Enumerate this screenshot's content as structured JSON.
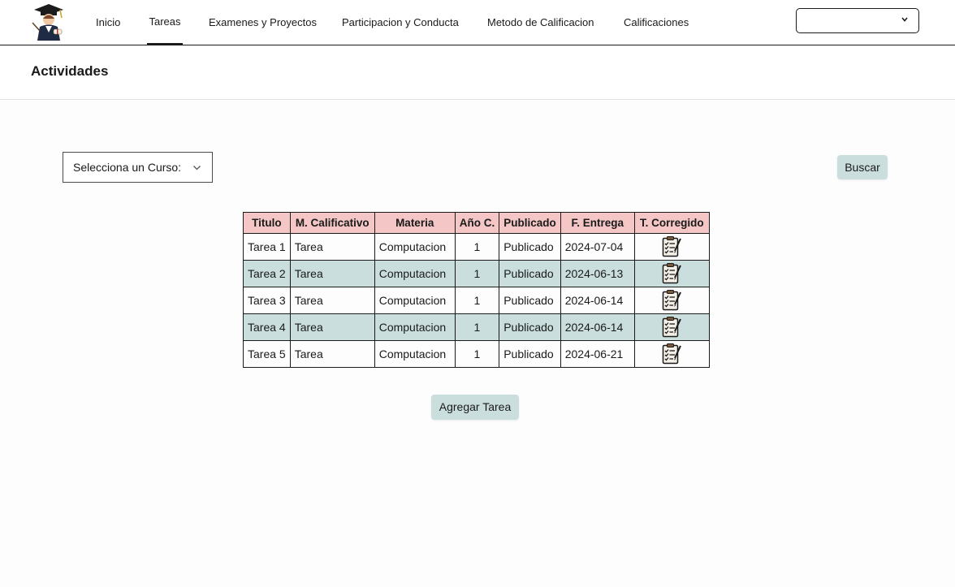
{
  "nav": {
    "items": [
      {
        "label": "Inicio"
      },
      {
        "label": "Tareas"
      },
      {
        "label": "Examenes y Proyectos"
      },
      {
        "label": "Participacion y Conducta"
      },
      {
        "label": "Metodo de Calificacion"
      },
      {
        "label": "Calificaciones"
      }
    ],
    "active": "Tareas",
    "user_select_value": ""
  },
  "page": {
    "title": "Actividades"
  },
  "filters": {
    "course_select_label": "Selecciona un Curso:",
    "search_label": "Buscar"
  },
  "table": {
    "headers": [
      "Titulo",
      "M. Calificativo",
      "Materia",
      "Año C.",
      "Publicado",
      "F. Entrega",
      "T. Corregido"
    ],
    "rows": [
      {
        "titulo": "Tarea 1",
        "metodo": "Tarea",
        "materia": "Computacion",
        "anio": "1",
        "publicado": "Publicado",
        "entrega": "2024-07-04"
      },
      {
        "titulo": "Tarea 2",
        "metodo": "Tarea",
        "materia": "Computacion",
        "anio": "1",
        "publicado": "Publicado",
        "entrega": "2024-06-13"
      },
      {
        "titulo": "Tarea 3",
        "metodo": "Tarea",
        "materia": "Computacion",
        "anio": "1",
        "publicado": "Publicado",
        "entrega": "2024-06-14"
      },
      {
        "titulo": "Tarea 4",
        "metodo": "Tarea",
        "materia": "Computacion",
        "anio": "1",
        "publicado": "Publicado",
        "entrega": "2024-06-14"
      },
      {
        "titulo": "Tarea 5",
        "metodo": "Tarea",
        "materia": "Computacion",
        "anio": "1",
        "publicado": "Publicado",
        "entrega": "2024-06-21"
      }
    ],
    "corrected_icon": "clipboard-checklist-icon"
  },
  "actions": {
    "add_label": "Agregar Tarea"
  },
  "colors": {
    "header_bg": "#f4c7c6",
    "alt_row_bg": "#c9dedd",
    "button_bg": "#c9dedd",
    "border": "#1a1a1a"
  }
}
